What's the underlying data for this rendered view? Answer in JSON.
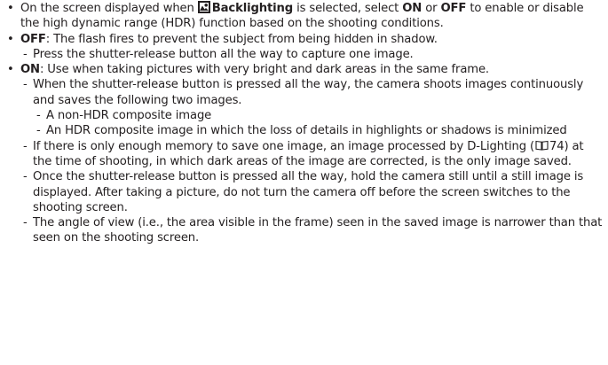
{
  "intro": {
    "t1": "On the screen displayed when",
    "scene_icon": "backlighting-scene-icon",
    "scene": "Backlighting",
    "t2": "is selected, select",
    "on": "ON",
    "t3": "or",
    "off": "OFF",
    "t4": "to enable or disable the high dynamic range (HDR) function based on the shooting conditions."
  },
  "off_item": {
    "label": "OFF",
    "text": ": The flash fires to prevent the subject from being hidden in shadow.",
    "sub1": "Press the shutter-release button all the way to capture one image."
  },
  "on_item": {
    "label": "ON",
    "text": ": Use when taking pictures with very bright and dark areas in the same frame.",
    "sub1": "When the shutter-release button is pressed all the way, the camera shoots images continuously and saves the following two images.",
    "sub1a": "A non-HDR composite image",
    "sub1b": "An HDR composite image in which the loss of details in highlights or shadows is minimized",
    "sub2a": "If there is only enough memory to save one image, an image processed by D-Lighting (",
    "ref_icon": "book-reference-icon",
    "ref_page": "74",
    "sub2b": ") at the time of shooting, in which dark areas of the image are corrected, is the only image saved.",
    "sub3": "Once the shutter-release button is pressed all the way, hold the camera still until a still image is displayed. After taking a picture, do not turn the camera off before the screen switches to the shooting screen.",
    "sub4": "The angle of view (i.e., the area visible in the frame) seen in the saved image is narrower than that seen on the shooting screen."
  }
}
